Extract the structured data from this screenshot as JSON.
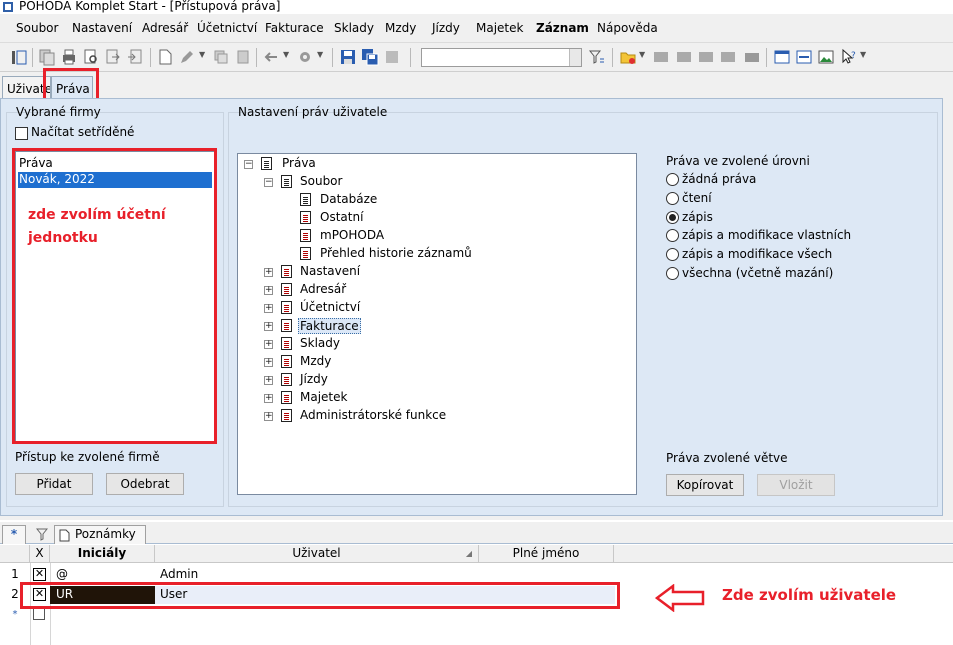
{
  "window": {
    "title": "POHODA Komplet Start - [Přístupová práva]"
  },
  "menu": [
    "Soubor",
    "Nastavení",
    "Adresář",
    "Účetnictví",
    "Fakturace",
    "Sklady",
    "Mzdy",
    "Jízdy",
    "Majetek",
    "Záznam",
    "Nápověda"
  ],
  "tabs": {
    "uzivatel": "Uživatel",
    "prava": "Práva"
  },
  "left": {
    "group_label": "Vybrané firmy",
    "sort_checkbox_label": "Načítat setříděné",
    "list_header": "Práva",
    "list_items": [
      "Novák, 2022"
    ],
    "annotation_line1": "zde zvolím účetní",
    "annotation_line2": "jednotku",
    "access_label": "Přístup ke zvolené firmě",
    "add_button": "Přidat",
    "remove_button": "Odebrat"
  },
  "rights": {
    "group_label": "Nastavení práv uživatele",
    "tree": {
      "root": "Práva",
      "soubor": "Soubor",
      "soubor_children": [
        "Databáze",
        "Ostatní",
        "mPOHODA",
        "Přehled historie záznamů"
      ],
      "nodes": [
        "Nastavení",
        "Adresář",
        "Účetnictví",
        "Fakturace",
        "Sklady",
        "Mzdy",
        "Jízdy",
        "Majetek",
        "Administrátorské funkce"
      ]
    },
    "level_label": "Práva ve zvolené úrovni",
    "levels": [
      "žádná práva",
      "čtení",
      "zápis",
      "zápis a modifikace vlastních",
      "zápis a modifikace všech",
      "všechna (včetně mazání)"
    ],
    "selected_level": "zápis",
    "branch_label": "Práva zvolené větve",
    "copy_button": "Kopírovat",
    "paste_button": "Vložit"
  },
  "bottom": {
    "tab_star": "*",
    "tab_notes": "Poznámky",
    "columns": {
      "x": "X",
      "initials": "Iniciály",
      "user": "Uživatel",
      "fullname": "Plné jméno"
    },
    "rows": [
      {
        "num": "1",
        "initials": "@",
        "user": "Admin"
      },
      {
        "num": "2",
        "initials": "UR",
        "user": "User"
      }
    ],
    "new_row_marker": "*",
    "annotation": "Zde zvolím uživatele"
  },
  "colors": {
    "annotation_red": "#e8202a",
    "selection_blue": "#1e6fd0",
    "panel_bg": "#dde8f5"
  }
}
